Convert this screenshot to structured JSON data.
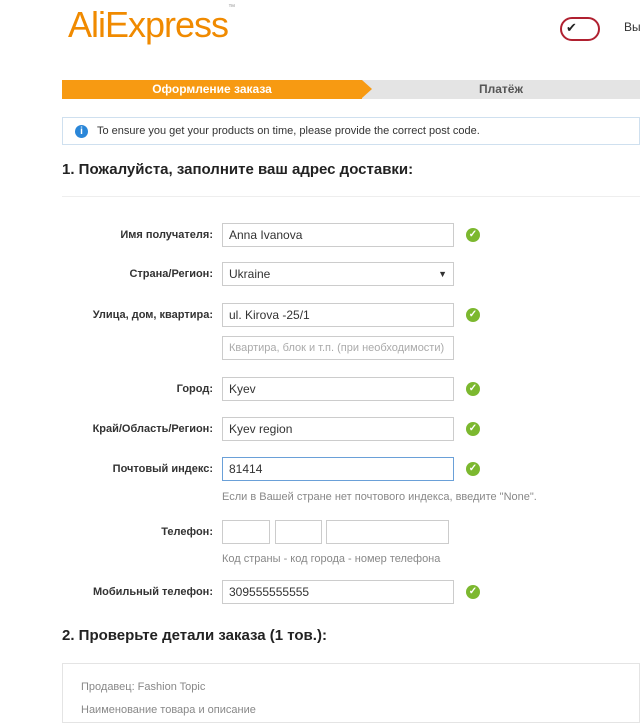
{
  "header": {
    "logo_text": "AliExpress",
    "logo_tm": "™",
    "verified_badge": "✔",
    "exit_text": "Вы"
  },
  "steps": [
    {
      "label": "Оформление заказа",
      "active": true
    },
    {
      "label": "Платёж",
      "active": false
    }
  ],
  "notice": {
    "icon": "info-icon",
    "text": "To ensure you get your products on time, please provide the correct post code."
  },
  "section1": {
    "title": "1. Пожалуйста, заполните ваш адрес доставки:"
  },
  "form": {
    "recipient": {
      "label": "Имя получателя:",
      "value": "Anna Ivanova"
    },
    "country": {
      "label": "Страна/Регион:",
      "value": "Ukraine"
    },
    "street": {
      "label": "Улица, дом, квартира:",
      "value": "ul. Kirova -25/1",
      "placeholder2": "Квартира, блок и т.п. (при необходимости)"
    },
    "city": {
      "label": "Город:",
      "value": "Kyev"
    },
    "region": {
      "label": "Край/Область/Регион:",
      "value": "Kyev region"
    },
    "zip": {
      "label": "Почтовый индекс:",
      "value": "81414",
      "hint": "Если в Вашей стране нет почтового индекса, введите \"None\"."
    },
    "phone": {
      "label": "Телефон:",
      "hint": "Код страны - код города - номер телефона"
    },
    "mobile": {
      "label": "Мобильный телефон:",
      "value": "309555555555"
    }
  },
  "section2": {
    "title": "2. Проверьте детали заказа (1 тов.):",
    "seller": "Продавец: Fashion Topic",
    "item_header": "Наименование товара и описание"
  },
  "colors": {
    "accent": "#f79a12",
    "valid": "#7cb82f",
    "info": "#2a86d8"
  }
}
